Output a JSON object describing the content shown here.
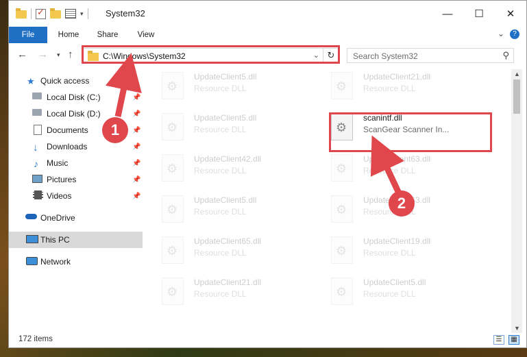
{
  "window": {
    "title": "System32"
  },
  "window_buttons": [
    "—",
    "☐",
    "✕"
  ],
  "ribbon": {
    "tabs": [
      "File",
      "Home",
      "Share",
      "View"
    ],
    "help": "?"
  },
  "address_bar": {
    "path": "C:\\Windows\\System32"
  },
  "search": {
    "placeholder": "Search System32"
  },
  "nav_pane": {
    "items": [
      {
        "label": "Quick access",
        "icon": "star-icon",
        "pinned": false
      },
      {
        "label": "Local Disk (C:)",
        "icon": "drive-icon",
        "pinned": true
      },
      {
        "label": "Local Disk (D:)",
        "icon": "drive-icon",
        "pinned": true
      },
      {
        "label": "Documents",
        "icon": "document-icon",
        "pinned": true
      },
      {
        "label": "Downloads",
        "icon": "download-arrow-icon",
        "pinned": true
      },
      {
        "label": "Music",
        "icon": "music-note-icon",
        "pinned": true
      },
      {
        "label": "Pictures",
        "icon": "picture-icon",
        "pinned": true
      },
      {
        "label": "Videos",
        "icon": "film-icon",
        "pinned": true
      },
      {
        "label": "OneDrive",
        "icon": "cloud-icon",
        "pinned": false
      },
      {
        "label": "This PC",
        "icon": "computer-icon",
        "pinned": false,
        "selected": true
      },
      {
        "label": "Network",
        "icon": "network-icon",
        "pinned": false
      }
    ]
  },
  "files": [
    {
      "name": "UpdateClient5.dll",
      "desc": "Resource DLL",
      "faded": true
    },
    {
      "name": "UpdateClient21.dll",
      "desc": "Resource DLL",
      "faded": true
    },
    {
      "name": "UpdateClient5.dll",
      "desc": "Resource DLL",
      "faded": true
    },
    {
      "name": "scanintf.dll",
      "desc": "ScanGear Scanner In...",
      "faded": false,
      "highlighted": true
    },
    {
      "name": "UpdateClient42.dll",
      "desc": "Resource DLL",
      "faded": true
    },
    {
      "name": "UpdateClient63.dll",
      "desc": "Resource DLL",
      "faded": true
    },
    {
      "name": "UpdateClient5.dll",
      "desc": "Resource DLL",
      "faded": true
    },
    {
      "name": "UpdateClient63.dll",
      "desc": "Resource DLL",
      "faded": true
    },
    {
      "name": "UpdateClient65.dll",
      "desc": "Resource DLL",
      "faded": true
    },
    {
      "name": "UpdateClient19.dll",
      "desc": "Resource DLL",
      "faded": true
    },
    {
      "name": "UpdateClient21.dll",
      "desc": "Resource DLL",
      "faded": true
    },
    {
      "name": "UpdateClient5.dll",
      "desc": "Resource DLL",
      "faded": true
    }
  ],
  "status_bar": {
    "item_count": "172 items"
  },
  "annotations": {
    "badge1": "1",
    "badge2": "2",
    "color": "#e0474c"
  },
  "colors": {
    "file_tab": "#1f6fc5",
    "selected_nav": "#d9d9d9",
    "highlight": "#e0474c"
  }
}
